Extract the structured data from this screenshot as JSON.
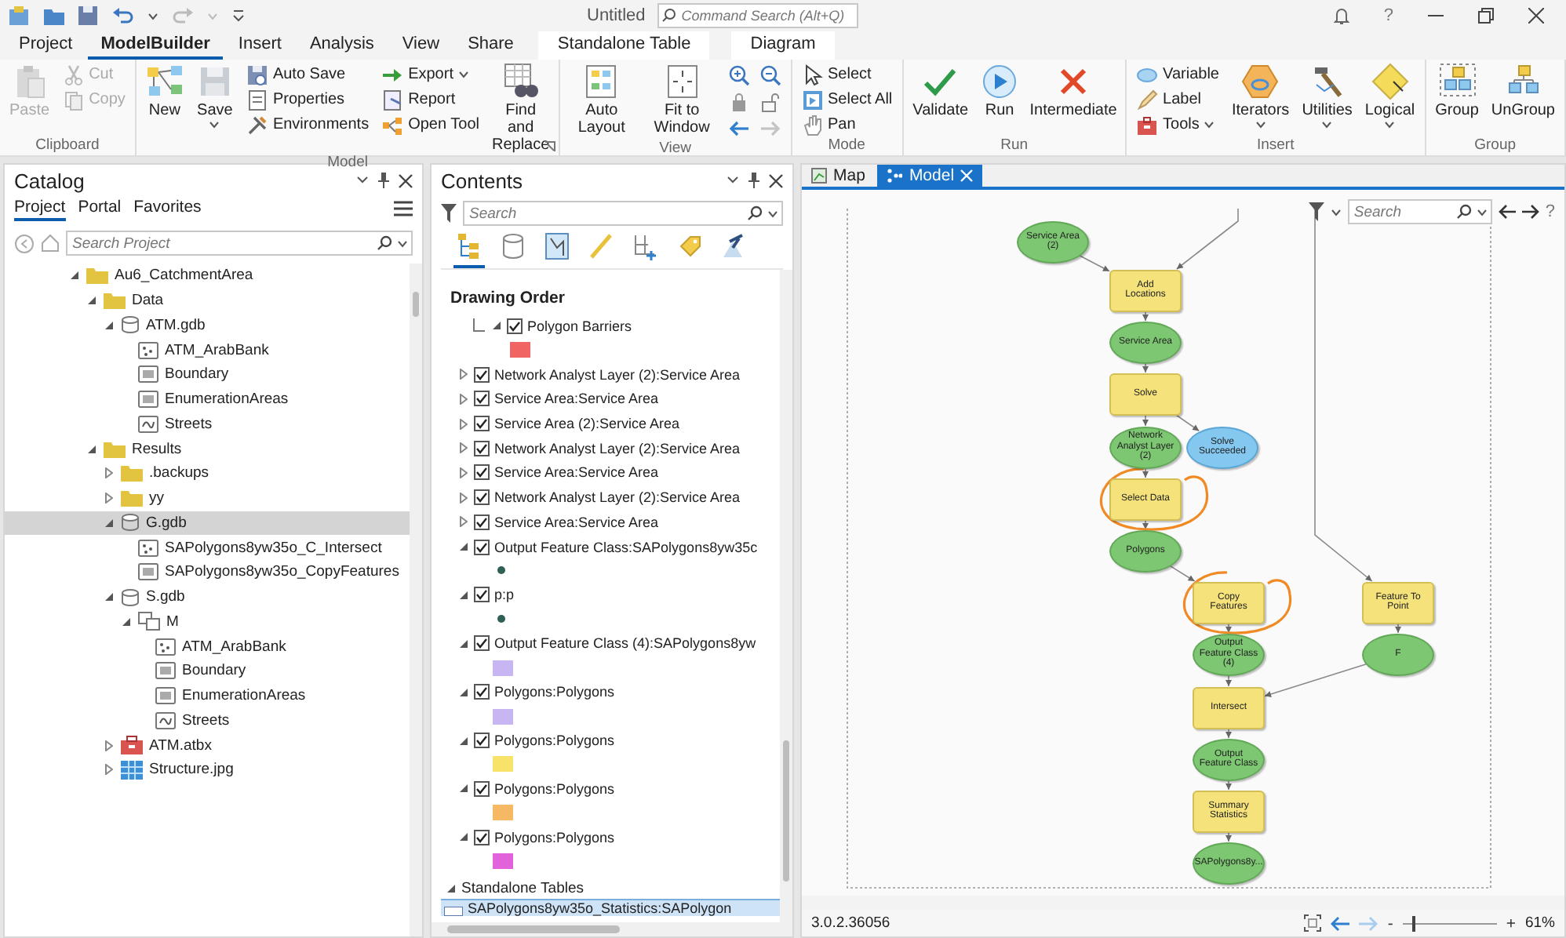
{
  "title_bar": {
    "title": "Untitled",
    "command_search": {
      "placeholder": "Command Search (Alt+Q)"
    },
    "help": "?"
  },
  "ribbon_tabs": [
    {
      "label": "Project",
      "selected": false,
      "kind": "tab"
    },
    {
      "label": "ModelBuilder",
      "selected": true,
      "kind": "tab"
    },
    {
      "label": "Insert",
      "selected": false,
      "kind": "tab"
    },
    {
      "label": "Analysis",
      "selected": false,
      "kind": "tab"
    },
    {
      "label": "View",
      "selected": false,
      "kind": "tab"
    },
    {
      "label": "Share",
      "selected": false,
      "kind": "tab"
    },
    {
      "label": "Standalone Table",
      "selected": false,
      "kind": "contextual"
    },
    {
      "label": "Diagram",
      "selected": false,
      "kind": "contextual"
    }
  ],
  "ribbon_groups": [
    {
      "label": "Clipboard",
      "launcher": false,
      "controls": [
        {
          "label": "Paste",
          "kind": "large",
          "disabled": true,
          "dropdown": false
        },
        {
          "label": "Cut",
          "kind": "small",
          "disabled": true,
          "dropdown": false
        },
        {
          "label": "Copy",
          "kind": "small",
          "disabled": true,
          "dropdown": false
        }
      ]
    },
    {
      "label": "Model",
      "launcher": true,
      "controls": [
        {
          "label": "New",
          "kind": "large",
          "disabled": false,
          "dropdown": false
        },
        {
          "label": "Save",
          "kind": "large",
          "disabled": false,
          "dropdown": true
        },
        {
          "label": "Auto Save",
          "kind": "small",
          "disabled": false,
          "dropdown": false
        },
        {
          "label": "Properties",
          "kind": "small",
          "disabled": false,
          "dropdown": false
        },
        {
          "label": "Environments",
          "kind": "small",
          "disabled": false,
          "dropdown": false
        },
        {
          "label": "Export",
          "kind": "small",
          "disabled": false,
          "dropdown": true
        },
        {
          "label": "Report",
          "kind": "small",
          "disabled": false,
          "dropdown": false
        },
        {
          "label": "Open Tool",
          "kind": "small",
          "disabled": false,
          "dropdown": false
        },
        {
          "label": "Find and Replace",
          "kind": "large",
          "disabled": false,
          "dropdown": false
        }
      ]
    },
    {
      "label": "View",
      "launcher": false,
      "controls": [
        {
          "label": "Auto Layout",
          "kind": "large",
          "disabled": false,
          "dropdown": false
        },
        {
          "label": "Fit to Window",
          "kind": "large",
          "disabled": false,
          "dropdown": false
        },
        {
          "kind": "nav-icons"
        }
      ]
    },
    {
      "label": "Mode",
      "launcher": false,
      "controls": [
        {
          "label": "Select",
          "kind": "small",
          "disabled": false,
          "dropdown": false
        },
        {
          "label": "Select All",
          "kind": "small",
          "disabled": false,
          "dropdown": false
        },
        {
          "label": "Pan",
          "kind": "small",
          "disabled": false,
          "dropdown": false
        }
      ]
    },
    {
      "label": "Run",
      "launcher": false,
      "controls": [
        {
          "label": "Validate",
          "kind": "large",
          "disabled": false,
          "dropdown": false
        },
        {
          "label": "Run",
          "kind": "large",
          "disabled": false,
          "dropdown": false
        },
        {
          "label": "Intermediate",
          "kind": "large",
          "disabled": false,
          "dropdown": false
        }
      ]
    },
    {
      "label": "Insert",
      "launcher": false,
      "controls": [
        {
          "label": "Variable",
          "kind": "small",
          "disabled": false,
          "dropdown": false
        },
        {
          "label": "Label",
          "kind": "small",
          "disabled": false,
          "dropdown": false
        },
        {
          "label": "Tools",
          "kind": "small",
          "disabled": false,
          "dropdown": true
        },
        {
          "label": "Iterators",
          "kind": "large",
          "disabled": false,
          "dropdown": true
        },
        {
          "label": "Utilities",
          "kind": "large",
          "disabled": false,
          "dropdown": true
        },
        {
          "label": "Logical",
          "kind": "large",
          "disabled": false,
          "dropdown": true
        }
      ]
    },
    {
      "label": "Group",
      "launcher": false,
      "controls": [
        {
          "label": "Group",
          "kind": "large",
          "disabled": false,
          "dropdown": false
        },
        {
          "label": "UnGroup",
          "kind": "large",
          "disabled": false,
          "dropdown": false
        }
      ]
    }
  ],
  "catalog": {
    "title": "Catalog",
    "tabs": [
      {
        "label": "Project",
        "selected": true
      },
      {
        "label": "Portal",
        "selected": false
      },
      {
        "label": "Favorites",
        "selected": false
      }
    ],
    "search": {
      "placeholder": "Search Project"
    },
    "tree": [
      {
        "label": "Au6_CatchmentArea",
        "kind": "folder",
        "expanded": true,
        "selected": false,
        "children": [
          {
            "label": "Data",
            "kind": "folder",
            "expanded": true,
            "selected": false,
            "children": [
              {
                "label": "ATM.gdb",
                "kind": "gdb",
                "expanded": true,
                "selected": false,
                "children": [
                  {
                    "label": "ATM_ArabBank",
                    "kind": "point",
                    "selected": false
                  },
                  {
                    "label": "Boundary",
                    "kind": "polygon",
                    "selected": false
                  },
                  {
                    "label": "EnumerationAreas",
                    "kind": "polygon",
                    "selected": false
                  },
                  {
                    "label": "Streets",
                    "kind": "line",
                    "selected": false
                  }
                ]
              }
            ]
          },
          {
            "label": "Results",
            "kind": "folder",
            "expanded": true,
            "selected": false,
            "children": [
              {
                "label": ".backups",
                "kind": "folder",
                "expanded": false,
                "selected": false
              },
              {
                "label": "yy",
                "kind": "folder",
                "expanded": false,
                "selected": false
              },
              {
                "label": "G.gdb",
                "kind": "gdb",
                "expanded": true,
                "selected": true,
                "children": [
                  {
                    "label": "SAPolygons8yw35o_C_Intersect",
                    "kind": "point",
                    "selected": false
                  },
                  {
                    "label": "SAPolygons8yw35o_CopyFeatures",
                    "kind": "polygon",
                    "selected": false
                  }
                ]
              },
              {
                "label": "S.gdb",
                "kind": "gdb",
                "expanded": true,
                "selected": false,
                "children": [
                  {
                    "label": "M",
                    "kind": "dataset",
                    "expanded": true,
                    "selected": false,
                    "children": [
                      {
                        "label": "ATM_ArabBank",
                        "kind": "point",
                        "selected": false
                      },
                      {
                        "label": "Boundary",
                        "kind": "polygon",
                        "selected": false
                      },
                      {
                        "label": "EnumerationAreas",
                        "kind": "polygon",
                        "selected": false
                      },
                      {
                        "label": "Streets",
                        "kind": "line",
                        "selected": false
                      }
                    ]
                  }
                ]
              },
              {
                "label": "ATM.atbx",
                "kind": "toolbox",
                "expanded": false,
                "selected": false
              },
              {
                "label": "Structure.jpg",
                "kind": "image",
                "expanded": false,
                "selected": false
              }
            ]
          }
        ]
      }
    ]
  },
  "contents": {
    "title": "Contents",
    "search": {
      "placeholder": "Search"
    },
    "view_tabs": [
      {
        "selected": true
      },
      {
        "selected": false
      },
      {
        "selected": false
      },
      {
        "selected": false
      },
      {
        "selected": false
      },
      {
        "selected": false
      },
      {
        "selected": false
      }
    ],
    "heading": "Drawing Order",
    "layers": [
      {
        "label": "Polygon Barriers",
        "kind": "polygon",
        "nested": true,
        "checked": true,
        "expanded": true,
        "color": "#f06464"
      },
      {
        "label": "Network Analyst Layer (2):Service Area",
        "kind": "layer",
        "nested": false,
        "checked": true,
        "expanded": false
      },
      {
        "label": "Service Area:Service Area",
        "kind": "layer",
        "nested": false,
        "checked": true,
        "expanded": false
      },
      {
        "label": "Service Area (2):Service Area",
        "kind": "layer",
        "nested": false,
        "checked": true,
        "expanded": false
      },
      {
        "label": "Network Analyst Layer (2):Service Area",
        "kind": "layer",
        "nested": false,
        "checked": true,
        "expanded": false
      },
      {
        "label": "Service Area:Service Area",
        "kind": "layer",
        "nested": false,
        "checked": true,
        "expanded": false
      },
      {
        "label": "Network Analyst Layer (2):Service Area",
        "kind": "layer",
        "nested": false,
        "checked": true,
        "expanded": false
      },
      {
        "label": "Service Area:Service Area",
        "kind": "layer",
        "nested": false,
        "checked": true,
        "expanded": false
      },
      {
        "label": "Output Feature Class:SAPolygons8yw35c",
        "kind": "point",
        "nested": false,
        "checked": true,
        "expanded": true,
        "color": "#2f5f55"
      },
      {
        "label": "p:p",
        "kind": "point",
        "nested": false,
        "checked": true,
        "expanded": true,
        "color": "#2f5f55"
      },
      {
        "label": "Output Feature Class (4):SAPolygons8yw",
        "kind": "polygon",
        "nested": false,
        "checked": true,
        "expanded": true,
        "color": "#c8b6f2"
      },
      {
        "label": "Polygons:Polygons",
        "kind": "polygon",
        "nested": false,
        "checked": true,
        "expanded": true,
        "color": "#c8b6f2"
      },
      {
        "label": "Polygons:Polygons",
        "kind": "polygon",
        "nested": false,
        "checked": true,
        "expanded": true,
        "color": "#f8e26a"
      },
      {
        "label": "Polygons:Polygons",
        "kind": "polygon",
        "nested": false,
        "checked": true,
        "expanded": true,
        "color": "#f5b964"
      },
      {
        "label": "Polygons:Polygons",
        "kind": "polygon",
        "nested": false,
        "checked": true,
        "expanded": true,
        "color": "#e262dc"
      }
    ],
    "tables_group": {
      "label": "Standalone Tables",
      "expanded": true,
      "tables": [
        {
          "label": "SAPolygons8yw35o_Statistics:SAPolygon",
          "selected": true
        }
      ]
    }
  },
  "model_view": {
    "tabs": [
      {
        "label": "Map",
        "selected": false,
        "closable": false
      },
      {
        "label": "Model",
        "selected": true,
        "closable": true
      }
    ],
    "search": {
      "placeholder": "Search"
    },
    "help": "?",
    "nodes": [
      {
        "label": "Service Area (2)",
        "kind": "data",
        "highlighted": false
      },
      {
        "label": "Add Locations",
        "kind": "tool",
        "highlighted": false
      },
      {
        "label": "Service Area",
        "kind": "data",
        "highlighted": false
      },
      {
        "label": "Solve",
        "kind": "tool",
        "highlighted": false
      },
      {
        "label": "Network Analyst Layer (2)",
        "kind": "data",
        "highlighted": false
      },
      {
        "label": "Solve Succeeded",
        "kind": "variable",
        "highlighted": false
      },
      {
        "label": "Select Data",
        "kind": "tool",
        "highlighted": true
      },
      {
        "label": "Polygons",
        "kind": "data",
        "highlighted": false
      },
      {
        "label": "Copy Features",
        "kind": "tool",
        "highlighted": true
      },
      {
        "label": "Feature To Point",
        "kind": "tool",
        "highlighted": false
      },
      {
        "label": "Output Feature Class (4)",
        "kind": "data",
        "highlighted": false
      },
      {
        "label": "F",
        "kind": "data",
        "highlighted": false
      },
      {
        "label": "Intersect",
        "kind": "tool",
        "highlighted": false
      },
      {
        "label": "Output Feature Class",
        "kind": "data",
        "highlighted": false
      },
      {
        "label": "Summary Statistics",
        "kind": "tool",
        "highlighted": false
      },
      {
        "label": "SAPolygons8y...",
        "kind": "data",
        "highlighted": false
      }
    ],
    "status": {
      "version": "3.0.2.36056",
      "zoom": {
        "minus": "-",
        "plus": "+",
        "level": 0.1,
        "reading": "61%"
      }
    }
  }
}
